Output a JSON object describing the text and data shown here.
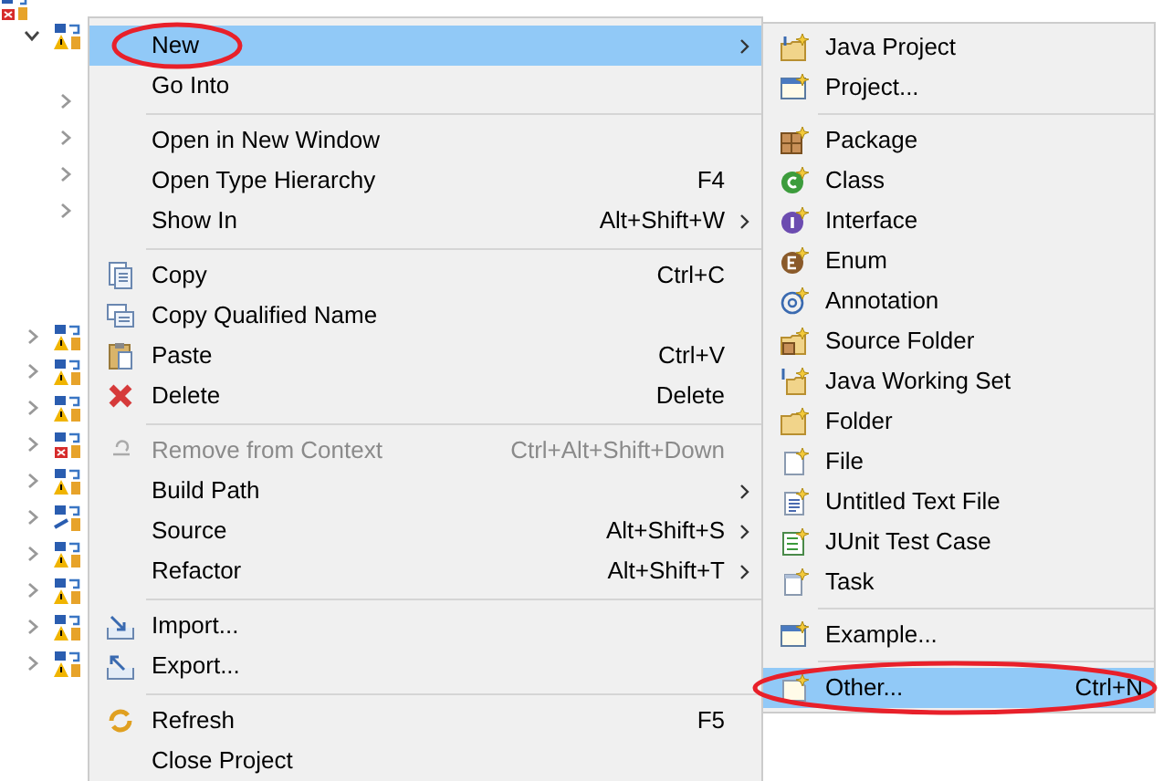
{
  "tree": {
    "rows": [
      {
        "warning": false,
        "error": true
      },
      {
        "expanded": true,
        "warning": true,
        "error": false,
        "children": [
          {
            "expanded": false
          },
          {
            "expanded": false
          },
          {
            "expanded": false
          },
          {
            "expanded": false
          }
        ]
      },
      {
        "expanded": false,
        "warning": true,
        "error": false
      },
      {
        "expanded": false,
        "warning": true,
        "error": false
      },
      {
        "expanded": false,
        "warning": true,
        "error": false
      },
      {
        "expanded": false,
        "warning": false,
        "error": true
      },
      {
        "expanded": false,
        "warning": true,
        "error": false
      },
      {
        "expanded": false,
        "warning": false,
        "error": false
      },
      {
        "expanded": false,
        "warning": true,
        "error": false
      },
      {
        "expanded": false,
        "warning": true,
        "error": false
      },
      {
        "expanded": false,
        "warning": true,
        "error": false
      },
      {
        "expanded": false,
        "warning": true,
        "error": false
      }
    ]
  },
  "context_menu": {
    "items": [
      {
        "kind": "item",
        "label": "New",
        "submenu": true,
        "selected": true,
        "disabled": false,
        "circled": true
      },
      {
        "kind": "item",
        "label": "Go Into",
        "submenu": false,
        "selected": false,
        "disabled": false
      },
      {
        "kind": "separator"
      },
      {
        "kind": "item",
        "label": "Open in New Window",
        "submenu": false,
        "selected": false,
        "disabled": false
      },
      {
        "kind": "item",
        "label": "Open Type Hierarchy",
        "shortcut": "F4",
        "submenu": false,
        "selected": false,
        "disabled": false
      },
      {
        "kind": "item",
        "label": "Show In",
        "shortcut": "Alt+Shift+W",
        "submenu": true,
        "selected": false,
        "disabled": false
      },
      {
        "kind": "separator"
      },
      {
        "kind": "item",
        "label": "Copy",
        "shortcut": "Ctrl+C",
        "submenu": false,
        "selected": false,
        "disabled": false
      },
      {
        "kind": "item",
        "label": "Copy Qualified Name",
        "submenu": false,
        "selected": false,
        "disabled": false
      },
      {
        "kind": "item",
        "label": "Paste",
        "shortcut": "Ctrl+V",
        "submenu": false,
        "selected": false,
        "disabled": false
      },
      {
        "kind": "item",
        "label": "Delete",
        "shortcut": "Delete",
        "submenu": false,
        "selected": false,
        "disabled": false
      },
      {
        "kind": "separator"
      },
      {
        "kind": "item",
        "label": "Remove from Context",
        "shortcut": "Ctrl+Alt+Shift+Down",
        "submenu": false,
        "selected": false,
        "disabled": true
      },
      {
        "kind": "item",
        "label": "Build Path",
        "submenu": true,
        "selected": false,
        "disabled": false
      },
      {
        "kind": "item",
        "label": "Source",
        "shortcut": "Alt+Shift+S",
        "submenu": true,
        "selected": false,
        "disabled": false
      },
      {
        "kind": "item",
        "label": "Refactor",
        "shortcut": "Alt+Shift+T",
        "submenu": true,
        "selected": false,
        "disabled": false
      },
      {
        "kind": "separator"
      },
      {
        "kind": "item",
        "label": "Import...",
        "submenu": false,
        "selected": false,
        "disabled": false
      },
      {
        "kind": "item",
        "label": "Export...",
        "submenu": false,
        "selected": false,
        "disabled": false
      },
      {
        "kind": "separator"
      },
      {
        "kind": "item",
        "label": "Refresh",
        "shortcut": "F5",
        "submenu": false,
        "selected": false,
        "disabled": false
      },
      {
        "kind": "item",
        "label": "Close Project",
        "submenu": false,
        "selected": false,
        "disabled": false
      }
    ]
  },
  "new_submenu": {
    "items": [
      {
        "kind": "item",
        "label": "Java Project",
        "selected": false
      },
      {
        "kind": "item",
        "label": "Project...",
        "selected": false
      },
      {
        "kind": "separator"
      },
      {
        "kind": "item",
        "label": "Package",
        "selected": false
      },
      {
        "kind": "item",
        "label": "Class",
        "selected": false
      },
      {
        "kind": "item",
        "label": "Interface",
        "selected": false
      },
      {
        "kind": "item",
        "label": "Enum",
        "selected": false
      },
      {
        "kind": "item",
        "label": "Annotation",
        "selected": false
      },
      {
        "kind": "item",
        "label": "Source Folder",
        "selected": false
      },
      {
        "kind": "item",
        "label": "Java Working Set",
        "selected": false
      },
      {
        "kind": "item",
        "label": "Folder",
        "selected": false
      },
      {
        "kind": "item",
        "label": "File",
        "selected": false
      },
      {
        "kind": "item",
        "label": "Untitled Text File",
        "selected": false
      },
      {
        "kind": "item",
        "label": "JUnit Test Case",
        "selected": false
      },
      {
        "kind": "item",
        "label": "Task",
        "selected": false
      },
      {
        "kind": "separator"
      },
      {
        "kind": "item",
        "label": "Example...",
        "selected": false
      },
      {
        "kind": "separator"
      },
      {
        "kind": "item",
        "label": "Other...",
        "shortcut": "Ctrl+N",
        "selected": true,
        "circled": true
      }
    ]
  }
}
